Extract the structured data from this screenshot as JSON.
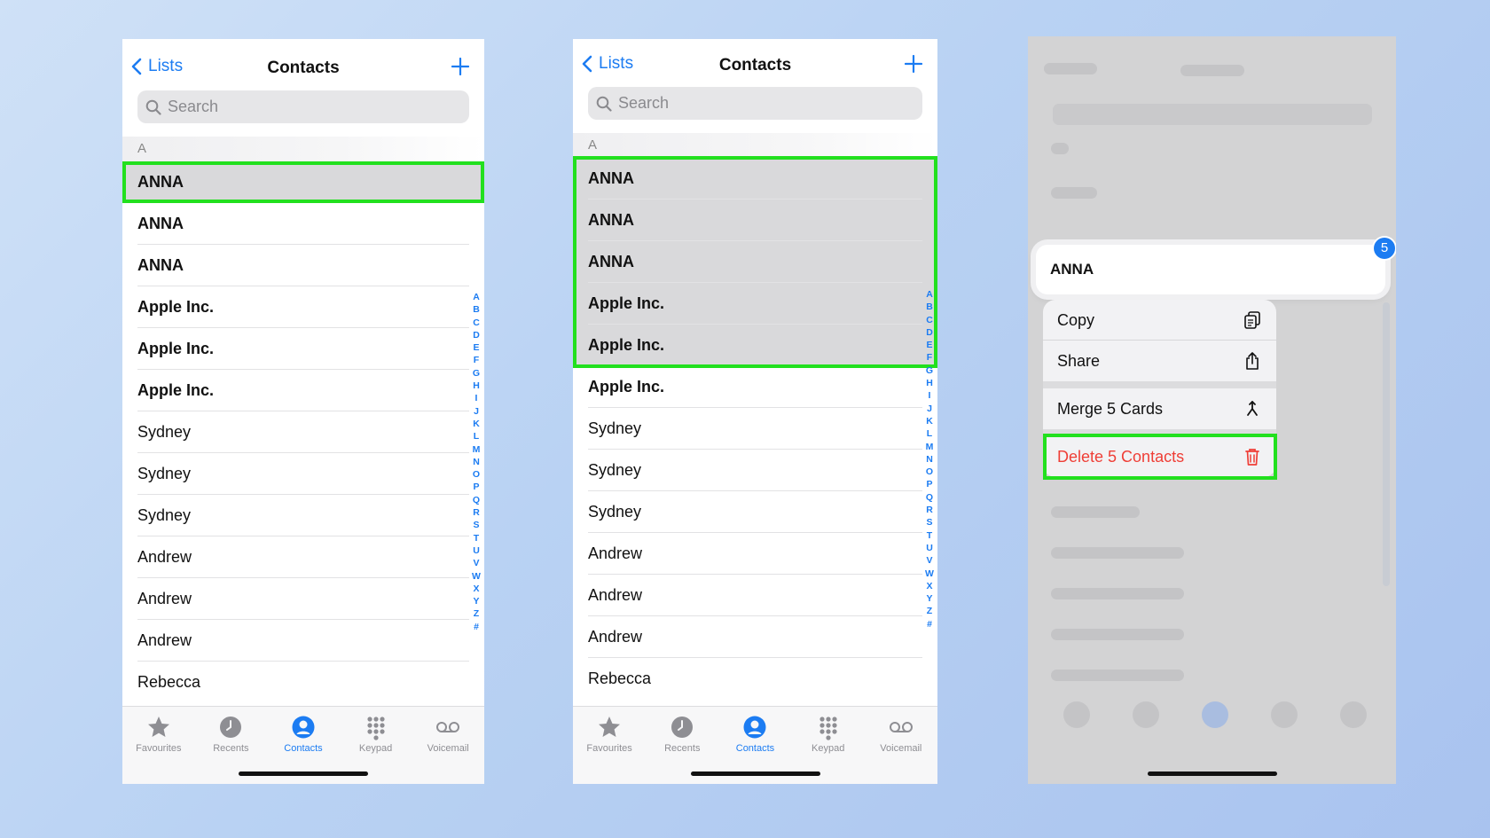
{
  "accent": "#1c7cf2",
  "highlight": "#22e01e",
  "danger": "#ef3e36",
  "phones": [
    {
      "nav": {
        "back": "Lists",
        "title": "Contacts",
        "add_icon": "plus-icon"
      },
      "search_placeholder": "Search",
      "section": "A",
      "rows": [
        "ANNA",
        "ANNA",
        "ANNA",
        "Apple Inc.",
        "Apple Inc.",
        "Apple Inc.",
        "Sydney",
        "Sydney",
        "Sydney",
        "Andrew",
        "Andrew",
        "Andrew",
        "Rebecca"
      ]
    },
    {
      "nav": {
        "back": "Lists",
        "title": "Contacts",
        "add_icon": "plus-icon"
      },
      "search_placeholder": "Search",
      "section": "A",
      "rows": [
        "ANNA",
        "ANNA",
        "ANNA",
        "Apple Inc.",
        "Apple Inc.",
        "Apple Inc.",
        "Sydney",
        "Sydney",
        "Sydney",
        "Andrew",
        "Andrew",
        "Andrew",
        "Rebecca"
      ]
    }
  ],
  "index_letters": [
    "A",
    "B",
    "C",
    "D",
    "E",
    "F",
    "G",
    "H",
    "I",
    "J",
    "K",
    "L",
    "M",
    "N",
    "O",
    "P",
    "Q",
    "R",
    "S",
    "T",
    "U",
    "V",
    "W",
    "X",
    "Y",
    "Z",
    "#"
  ],
  "tabs": [
    {
      "label": "Favourites",
      "icon": "star-icon"
    },
    {
      "label": "Recents",
      "icon": "clock-icon"
    },
    {
      "label": "Contacts",
      "icon": "person-circle-icon"
    },
    {
      "label": "Keypad",
      "icon": "keypad-icon"
    },
    {
      "label": "Voicemail",
      "icon": "voicemail-icon"
    }
  ],
  "context": {
    "preview_name": "ANNA",
    "badge_count": "5",
    "menu": {
      "copy": "Copy",
      "share": "Share",
      "merge": "Merge 5 Cards",
      "delete": "Delete 5 Contacts"
    }
  }
}
